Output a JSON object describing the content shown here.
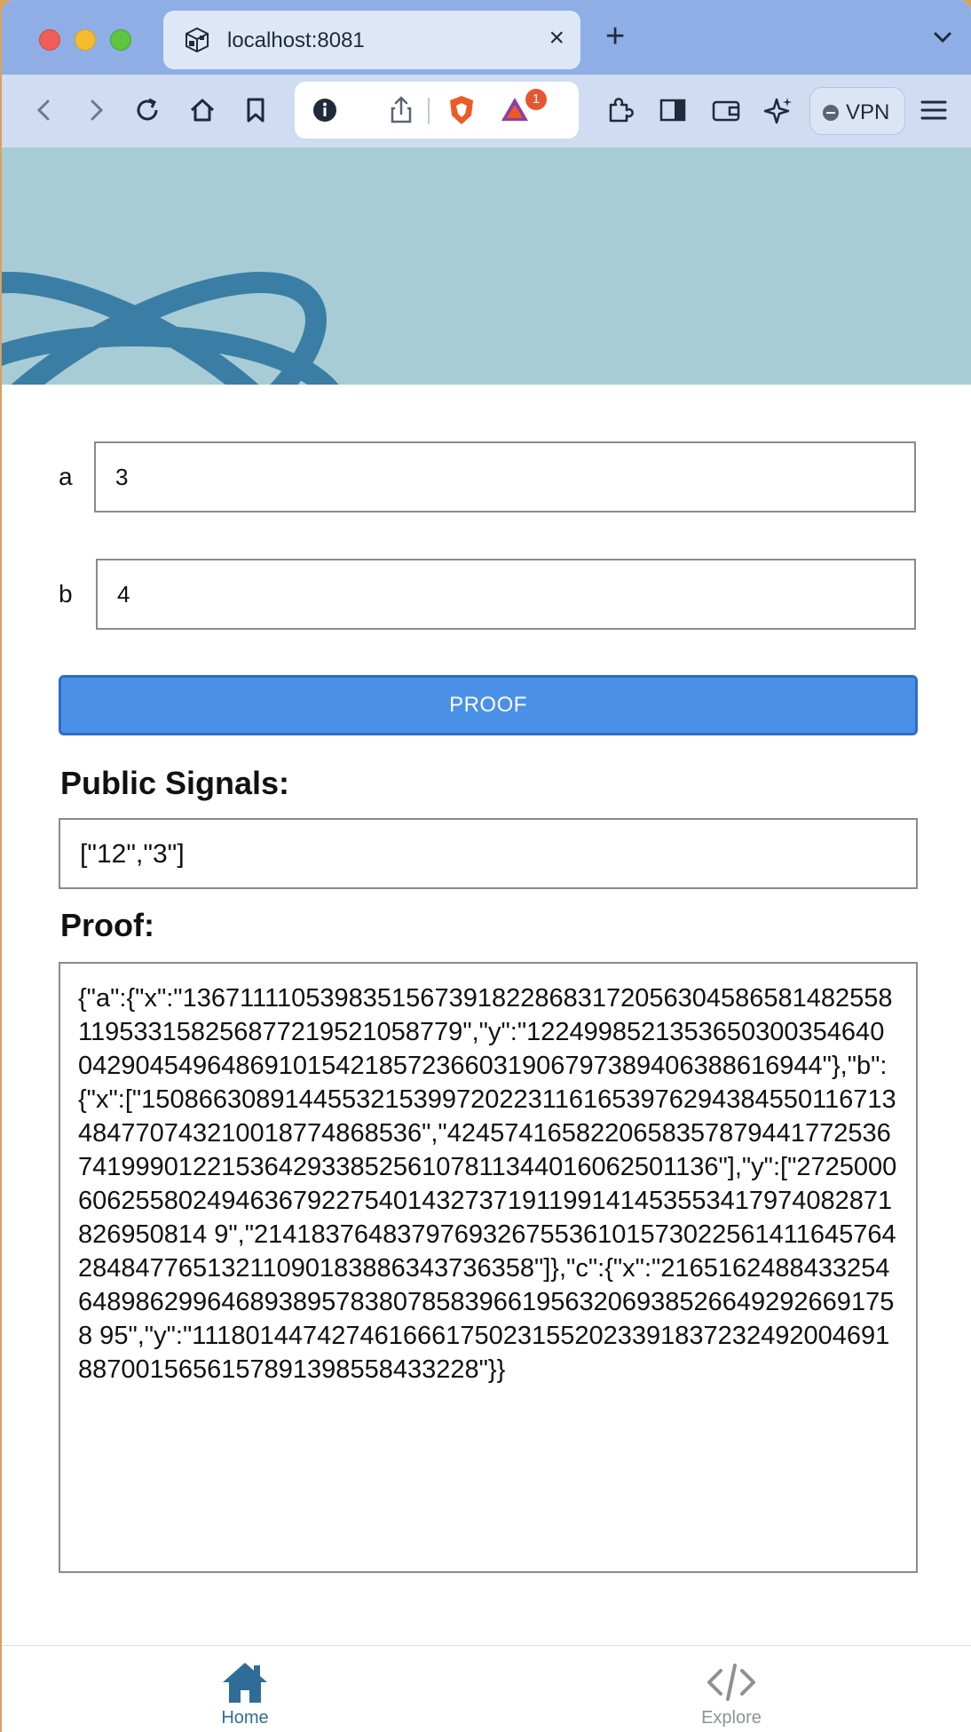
{
  "browser": {
    "tab_title": "localhost:8081",
    "close_symbol": "×",
    "new_tab_symbol": "+",
    "vpn_label": "VPN",
    "notification_count": "1",
    "accent": "#8faee6"
  },
  "icons": [
    "traffic-light-close",
    "traffic-light-minimize",
    "traffic-light-maximize",
    "back-icon",
    "forward-icon",
    "reload-icon",
    "home-icon",
    "bookmark-icon",
    "info-icon",
    "share-icon",
    "brave-shields-icon",
    "brave-rewards-icon",
    "extensions-icon",
    "sidebar-icon",
    "wallet-icon",
    "leo-ai-icon",
    "menu-icon"
  ],
  "form": {
    "a_label": "a",
    "a_value": "3",
    "b_label": "b",
    "b_value": "4",
    "button_label": "PROOF",
    "button_color": "#4a90e6"
  },
  "results": {
    "public_signals_title": "Public Signals:",
    "public_signals_value": "[\"12\",\"3\"]",
    "proof_title": "Proof:",
    "proof_value": "{\"a\":{\"x\":\"13671111053983515673918228683172056304586581482558119533158256877219521058779\",\"y\":\"12249985213536503003546400429045496486910154218572366031906797389406388616944\"},\"b\":{\"x\":[\"15086630891445532153997202231161653976294384550116713484770743210018774868536\",\"4245741658220658357879441772536741999012215364293385256107811344016062501136\"],\"y\":[\"2725000606255802494636792275401432737191199141453553417974082871826950814 9\",\"21418376483797693267553610157302256141164576428484776513211090183886343736358\"]},\"c\":{\"x\":\"21651624884332546489862996468938957838078583966195632069385266492926691758 95\",\"y\":\"11180144742746166617502315520233918372324920046918870015656157891398558433228\"}}"
  },
  "bottom_nav": {
    "home_label": "Home",
    "explore_label": "Explore",
    "active_color": "#2f6d96",
    "inactive_color": "#8d9196"
  }
}
